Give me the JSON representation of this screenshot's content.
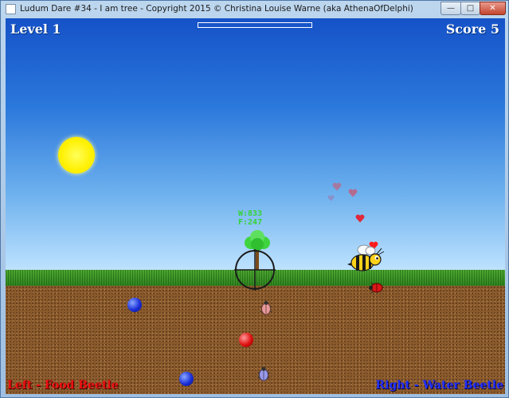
{
  "window": {
    "title": "Ludum Dare #34 - I am tree - Copyright 2015 © Christina Louise Warne (aka AthenaOfDelphi)",
    "minimize_glyph": "—",
    "maximize_glyph": "□",
    "close_glyph": "✕"
  },
  "hud": {
    "level": "Level 1",
    "score": "Score 5",
    "progress_fraction": 0.0
  },
  "tree": {
    "stat_line_1": "W:833",
    "stat_line_2": "F:247"
  },
  "controls": {
    "left_hint": "Left - Food Beetle",
    "right_hint": "Right - Water Beetle"
  },
  "colors": {
    "sky_top": "#1552c8",
    "grass": "#3d9428",
    "dirt": "#8a5a2c",
    "sun": "#fff000",
    "stat_text": "#33d433",
    "left_hint": "#ee1010",
    "right_hint": "#2030ff"
  }
}
